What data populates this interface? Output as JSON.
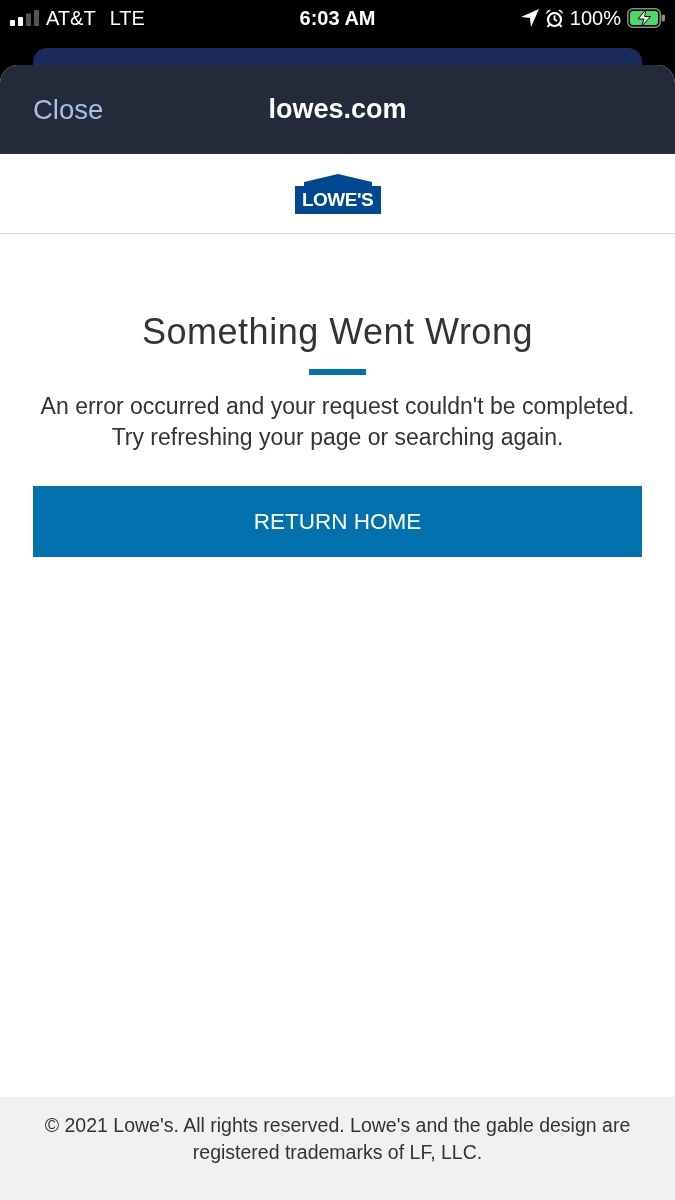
{
  "status_bar": {
    "carrier": "AT&T",
    "network": "LTE",
    "time": "6:03 AM",
    "battery_percent": "100%"
  },
  "sheet": {
    "close_button": "Close",
    "title": "lowes.com"
  },
  "header": {
    "logo_text": "LOWE'S"
  },
  "error": {
    "title": "Something Went Wrong",
    "message": "An error occurred and your request couldn't be completed. Try refreshing your page or searching again.",
    "button": "RETURN HOME"
  },
  "footer": {
    "text": "© 2021 Lowe's. All rights reserved. Lowe's and the gable design are registered trademarks of LF, LLC."
  }
}
